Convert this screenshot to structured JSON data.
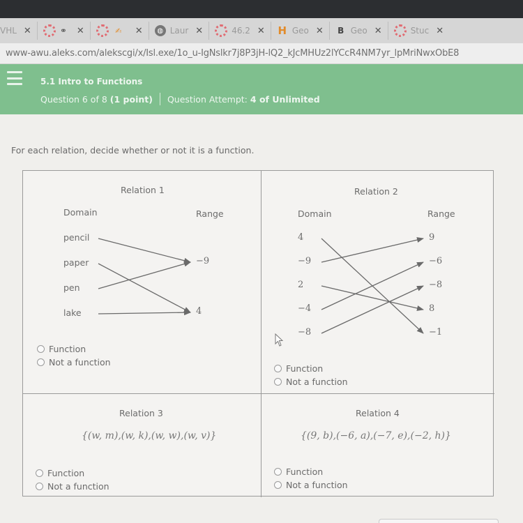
{
  "browser": {
    "tabs": [
      {
        "icon": "partial-icon",
        "label": "VHL",
        "partial": true
      },
      {
        "icon": "aleks-icon",
        "icon2": "binoculars-icon",
        "label": ""
      },
      {
        "icon": "aleks-icon",
        "icon2": "grade-icon",
        "label": ""
      },
      {
        "icon": "globe-icon",
        "label": "Laur"
      },
      {
        "icon": "aleks-icon",
        "label": "46.2"
      },
      {
        "icon": "h-icon",
        "label": "Geo"
      },
      {
        "icon": "b-icon",
        "label": "Geo"
      },
      {
        "icon": "aleks-icon",
        "label": "Stuc"
      }
    ],
    "close_glyph": "✕",
    "url": "www-awu.aleks.com/alekscgi/x/Isl.exe/1o_u-IgNslkr7j8P3jH-lQ2_kJcMHUz2lYCcR4NM7yr_lpMriNwxObE8"
  },
  "header": {
    "topic": "5.1 Intro to Functions",
    "question_prefix": "Question 6 of 8",
    "question_points": "(1 point)",
    "attempt_prefix": "Question Attempt:",
    "attempt_value": "4 of Unlimited"
  },
  "instructions": "For each relation, decide whether or not it is a function.",
  "relations": [
    {
      "title": "Relation 1",
      "domain_label": "Domain",
      "range_label": "Range",
      "domain": [
        "pencil",
        "paper",
        "pen",
        "lake"
      ],
      "range": [
        "−9",
        "4"
      ],
      "mappings": [
        [
          0,
          0
        ],
        [
          1,
          1
        ],
        [
          2,
          0
        ],
        [
          3,
          1
        ]
      ],
      "options": [
        "Function",
        "Not a function"
      ]
    },
    {
      "title": "Relation 2",
      "domain_label": "Domain",
      "range_label": "Range",
      "domain": [
        "4",
        "−9",
        "2",
        "−4",
        "−8"
      ],
      "range": [
        "9",
        "−6",
        "−8",
        "8",
        "−1"
      ],
      "mappings": [
        [
          0,
          4
        ],
        [
          1,
          0
        ],
        [
          2,
          3
        ],
        [
          3,
          1
        ],
        [
          4,
          2
        ]
      ],
      "options": [
        "Function",
        "Not a function"
      ]
    },
    {
      "title": "Relation 3",
      "set": "{(w, m),(w, k),(w, w),(w, v)}",
      "options": [
        "Function",
        "Not a function"
      ]
    },
    {
      "title": "Relation 4",
      "set": "{(9, b),(−6, a),(−7, e),(−2, h)}",
      "options": [
        "Function",
        "Not a function"
      ]
    }
  ]
}
